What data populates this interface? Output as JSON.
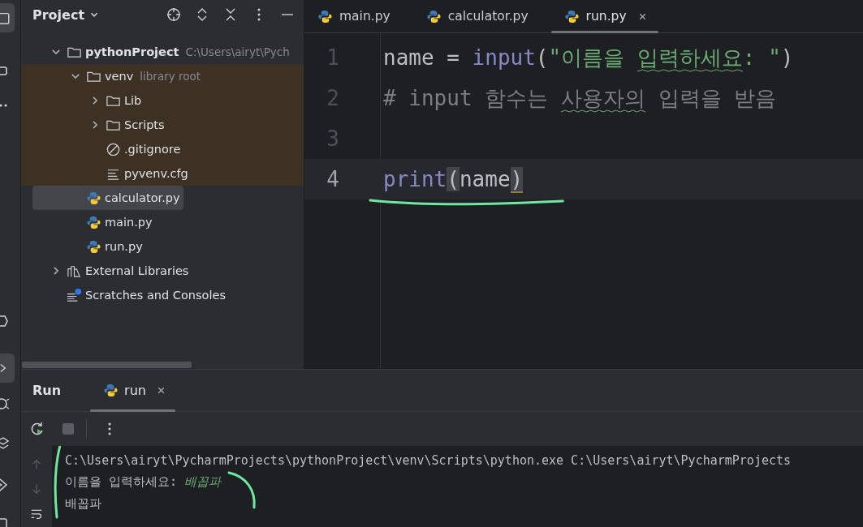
{
  "project": {
    "title": "Project",
    "tree": [
      {
        "label": "pythonProject",
        "hint": "C:\\Users\\airyt\\Pych",
        "kind": "folder",
        "bold": true,
        "expanded": true,
        "selected": false,
        "children": [
          {
            "label": "venv",
            "hint": "library root",
            "kind": "folder",
            "library_root": true,
            "expanded": true,
            "selected": false,
            "children": [
              {
                "label": "Lib",
                "kind": "folder",
                "expanded": false,
                "selected": false
              },
              {
                "label": "Scripts",
                "kind": "folder",
                "expanded": false,
                "selected": false
              },
              {
                "label": ".gitignore",
                "kind": "ignore",
                "selected": false
              },
              {
                "label": "pyvenv.cfg",
                "kind": "text",
                "selected": false
              }
            ]
          },
          {
            "label": "calculator.py",
            "kind": "python",
            "selected": true
          },
          {
            "label": "main.py",
            "kind": "python",
            "selected": false
          },
          {
            "label": "run.py",
            "kind": "python",
            "selected": false
          }
        ]
      },
      {
        "label": "External Libraries",
        "kind": "libraries",
        "expanded": false,
        "selected": false
      },
      {
        "label": "Scratches and Consoles",
        "kind": "scratches",
        "selected": false
      }
    ]
  },
  "editor": {
    "tabs": [
      {
        "label": "main.py",
        "selected": false,
        "closable": false
      },
      {
        "label": "calculator.py",
        "selected": false,
        "closable": false
      },
      {
        "label": "run.py",
        "selected": true,
        "closable": true
      }
    ],
    "lines": [
      {
        "number": "1",
        "current": false,
        "tokens": [
          {
            "text": "name = ",
            "kind": "plain",
            "squiggle": false
          },
          {
            "text": "input",
            "kind": "builtin",
            "squiggle": false
          },
          {
            "text": "(",
            "kind": "plain",
            "squiggle": false
          },
          {
            "text": "\"이름을 ",
            "kind": "string",
            "squiggle": false
          },
          {
            "text": "입력하세요",
            "kind": "string",
            "squiggle": true
          },
          {
            "text": ": \"",
            "kind": "string",
            "squiggle": false
          },
          {
            "text": ")",
            "kind": "plain",
            "squiggle": false
          }
        ]
      },
      {
        "number": "2",
        "current": false,
        "tokens": [
          {
            "text": "# input 함수는 ",
            "kind": "comment",
            "squiggle": false
          },
          {
            "text": "사용자의",
            "kind": "comment",
            "squiggle": true
          },
          {
            "text": " 입력을 받음",
            "kind": "comment",
            "squiggle": false
          }
        ]
      },
      {
        "number": "3",
        "current": false
      },
      {
        "number": "4",
        "current": true,
        "tokens": [
          {
            "text": "print",
            "kind": "builtin",
            "squiggle": false
          },
          {
            "text": "(",
            "kind": "brace",
            "squiggle": false
          },
          {
            "text": "name",
            "kind": "plain",
            "squiggle": false
          },
          {
            "text": ")",
            "kind": "brace",
            "squiggle": true
          }
        ]
      }
    ]
  },
  "run": {
    "title": "Run",
    "tabs": [
      {
        "label": "run",
        "selected": true
      }
    ],
    "console": [
      [
        {
          "text": "C:\\Users\\airyt\\PycharmProjects\\pythonProject\\venv\\Scripts\\python.exe C:\\Users\\airyt\\PycharmProjects",
          "kind": "output"
        }
      ],
      [
        {
          "text": "이름을 입력하세요: ",
          "kind": "output"
        },
        {
          "text": "배꼽파",
          "kind": "input"
        }
      ],
      [
        {
          "text": "배꼽파",
          "kind": "output"
        }
      ]
    ]
  }
}
